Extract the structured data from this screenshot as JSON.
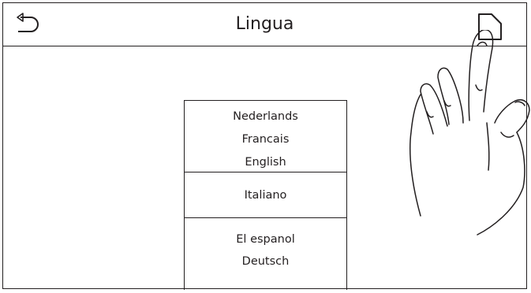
{
  "header": {
    "title": "Lingua",
    "back_icon": "back-arrow-icon",
    "home_icon": "home-icon"
  },
  "language_picker": {
    "options": [
      "Nederlands",
      "Francais",
      "English",
      "Italiano",
      "El espanol",
      "Deutsch"
    ],
    "selected": "Italiano"
  },
  "overlay": {
    "icon": "pointing-hand-icon"
  }
}
